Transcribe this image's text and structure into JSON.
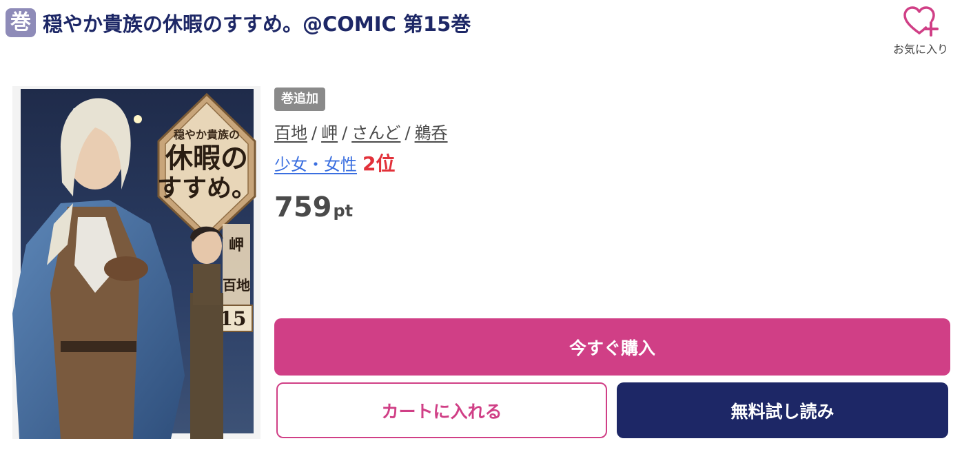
{
  "header": {
    "badge": "巻",
    "title": "穏やか貴族の休暇のすすめ。@COMIC 第15巻"
  },
  "favorite": {
    "label": "お気に入り",
    "icon": "heart-plus-icon",
    "color": "#d03f86"
  },
  "cover": {
    "title_lines": [
      "穏やか貴族の",
      "休暇の",
      "すすめ。"
    ],
    "volume": "15",
    "credit_1": "岬",
    "credit_2": "百地"
  },
  "info": {
    "tag": "巻追加",
    "authors": [
      "百地",
      "岬",
      "さんど",
      "鵜呑"
    ],
    "author_separator": "/",
    "genre": "少女・女性",
    "rank": "2位",
    "price_value": "759",
    "price_unit": "pt"
  },
  "buttons": {
    "buy": "今すぐ購入",
    "cart": "カートに入れる",
    "trial": "無料試し読み"
  },
  "colors": {
    "brand_navy": "#1d2766",
    "accent_pink": "#d03f86",
    "badge_purple": "#8e8bb8",
    "rank_red": "#e2313a",
    "genre_blue": "#3b6fe0"
  }
}
